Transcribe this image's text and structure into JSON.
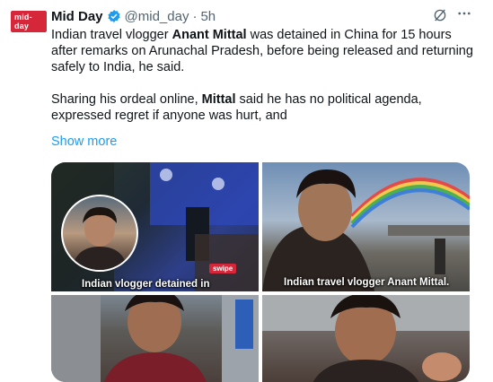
{
  "tweet": {
    "author_name": "Mid Day",
    "avatar_logo_text": "mid-day",
    "handle": "@mid_day",
    "separator": "·",
    "time": "5h",
    "paragraph1": {
      "seg1": "Indian travel vlogger ",
      "seg2": "Anant Mittal",
      "seg3": " was detained in China for 15 hours after remarks on Arunachal Pradesh, before being released and returning safely to India, he said."
    },
    "paragraph2": {
      "seg1": "Sharing his ordeal online, ",
      "seg2": "Mittal",
      "seg3": " said he has no political agenda, expressed regret if anyone was hurt, and"
    },
    "show_more_label": "Show more"
  },
  "media": {
    "image1_caption": "Indian vlogger detained in",
    "image1_badge": "swipe",
    "image2_caption": "Indian travel vlogger Anant Mittal."
  },
  "icons": {
    "verified": "verified-badge-icon",
    "grok": "grok-icon",
    "more": "more-icon"
  },
  "colors": {
    "accent": "#1d9bf0",
    "text": "#0f1419",
    "secondary": "#536471",
    "brand_red": "#d6263a"
  }
}
